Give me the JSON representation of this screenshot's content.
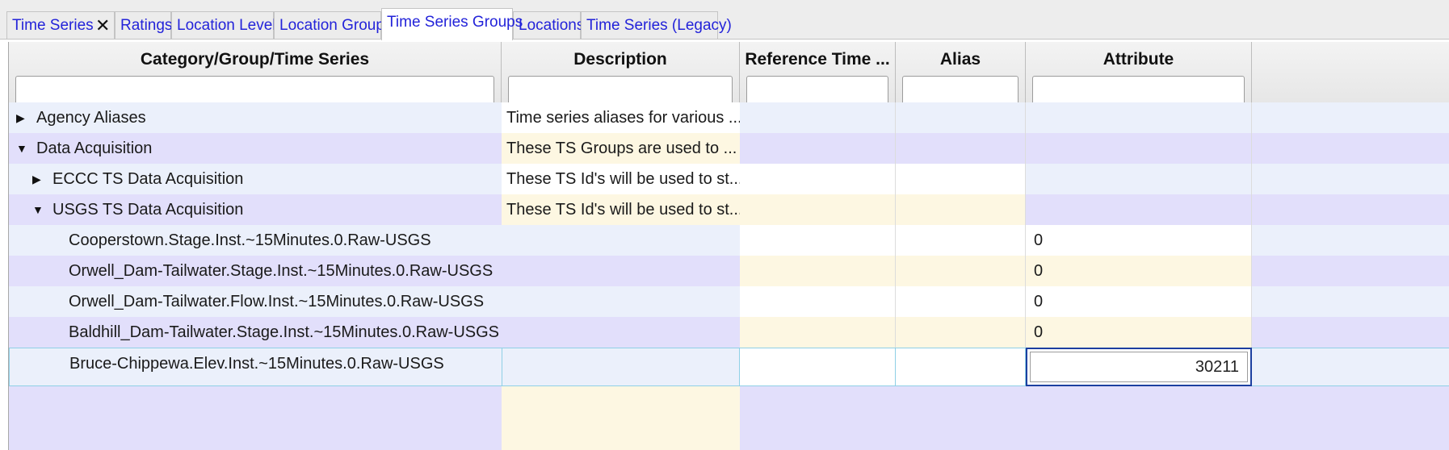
{
  "tabs": [
    {
      "label": "Time Series",
      "closable": true
    },
    {
      "label": "Ratings"
    },
    {
      "label": "Location Levels"
    },
    {
      "label": "Location Groups"
    },
    {
      "label": "Time Series Groups",
      "active": true
    },
    {
      "label": "Locations"
    },
    {
      "label": "Time Series (Legacy)"
    }
  ],
  "close_glyph": "✕",
  "columns": [
    {
      "title": "Category/Group/Time Series",
      "filter": ""
    },
    {
      "title": "Description",
      "filter": ""
    },
    {
      "title": "Reference Time ...",
      "filter": ""
    },
    {
      "title": "Alias",
      "filter": ""
    },
    {
      "title": "Attribute",
      "filter": ""
    }
  ],
  "rows": [
    {
      "name": "Agency Aliases",
      "level": 0,
      "expander": "collapsed",
      "description": "Time series aliases for various ...",
      "reference_time": "",
      "alias": "",
      "attribute": ""
    },
    {
      "name": "Data Acquisition",
      "level": 0,
      "expander": "expanded",
      "description": "These TS Groups are used to ...",
      "reference_time": "",
      "alias": "",
      "attribute": ""
    },
    {
      "name": "ECCC TS Data Acquisition",
      "level": 1,
      "expander": "collapsed",
      "description": "These TS Id's will be used to st...",
      "reference_time": "",
      "alias": "",
      "attribute": ""
    },
    {
      "name": "USGS TS Data Acquisition",
      "level": 1,
      "expander": "expanded",
      "description": "These TS Id's will be used to st...",
      "reference_time": "",
      "alias": "",
      "attribute": ""
    },
    {
      "name": "Cooperstown.Stage.Inst.~15Minutes.0.Raw-USGS",
      "level": 2,
      "description": "",
      "reference_time": "",
      "alias": "",
      "attribute": "0"
    },
    {
      "name": "Orwell_Dam-Tailwater.Stage.Inst.~15Minutes.0.Raw-USGS",
      "level": 2,
      "description": "",
      "reference_time": "",
      "alias": "",
      "attribute": "0"
    },
    {
      "name": "Orwell_Dam-Tailwater.Flow.Inst.~15Minutes.0.Raw-USGS",
      "level": 2,
      "description": "",
      "reference_time": "",
      "alias": "",
      "attribute": "0"
    },
    {
      "name": "Baldhill_Dam-Tailwater.Stage.Inst.~15Minutes.0.Raw-USGS",
      "level": 2,
      "description": "",
      "reference_time": "",
      "alias": "",
      "attribute": "0"
    },
    {
      "name": "Bruce-Chippewa.Elev.Inst.~15Minutes.0.Raw-USGS",
      "level": 2,
      "description": "",
      "reference_time": "",
      "alias": "",
      "attribute": "30211",
      "selected": true,
      "editing": true
    }
  ],
  "expander_glyphs": {
    "collapsed": "▶",
    "expanded": "▼"
  },
  "colors": {
    "tab_text": "#2323d9",
    "row_light": "#ebf0fb",
    "row_lavender": "#e2dffb",
    "row_cream": "#fdf7e2",
    "editor_border": "#1c3fa0",
    "selection_border": "#8fd0e6"
  }
}
